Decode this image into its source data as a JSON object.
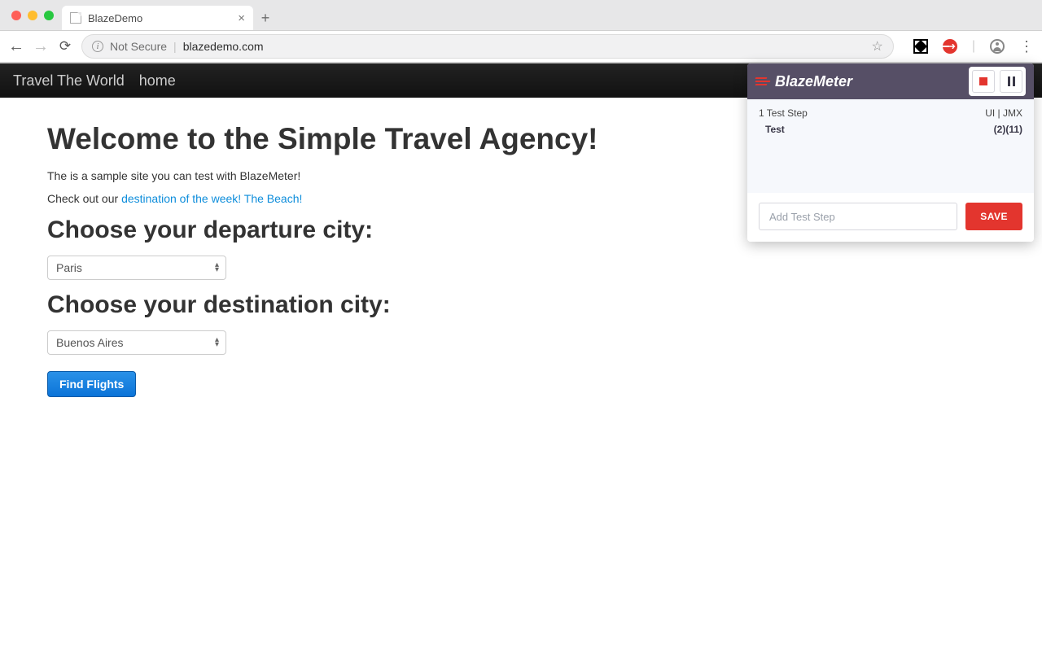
{
  "browser": {
    "tab_title": "BlazeDemo",
    "address": {
      "security_label": "Not Secure",
      "url": "blazedemo.com"
    }
  },
  "nav": {
    "brand": "Travel The World",
    "home": "home"
  },
  "page": {
    "heading": "Welcome to the Simple Travel Agency!",
    "intro": "The is a sample site you can test with BlazeMeter!",
    "checkout_prefix": "Check out our ",
    "checkout_link": "destination of the week! The Beach!",
    "departure_heading": "Choose your departure city:",
    "departure_value": "Paris",
    "destination_heading": "Choose your destination city:",
    "destination_value": "Buenos Aires",
    "find_button": "Find Flights"
  },
  "blazemeter": {
    "logo_text": "BlazeMeter",
    "step_count_label": "1 Test Step",
    "mode_label": "UI | JMX",
    "step_name": "Test",
    "step_counts": "(2)(11)",
    "add_placeholder": "Add Test Step",
    "save_label": "SAVE"
  }
}
